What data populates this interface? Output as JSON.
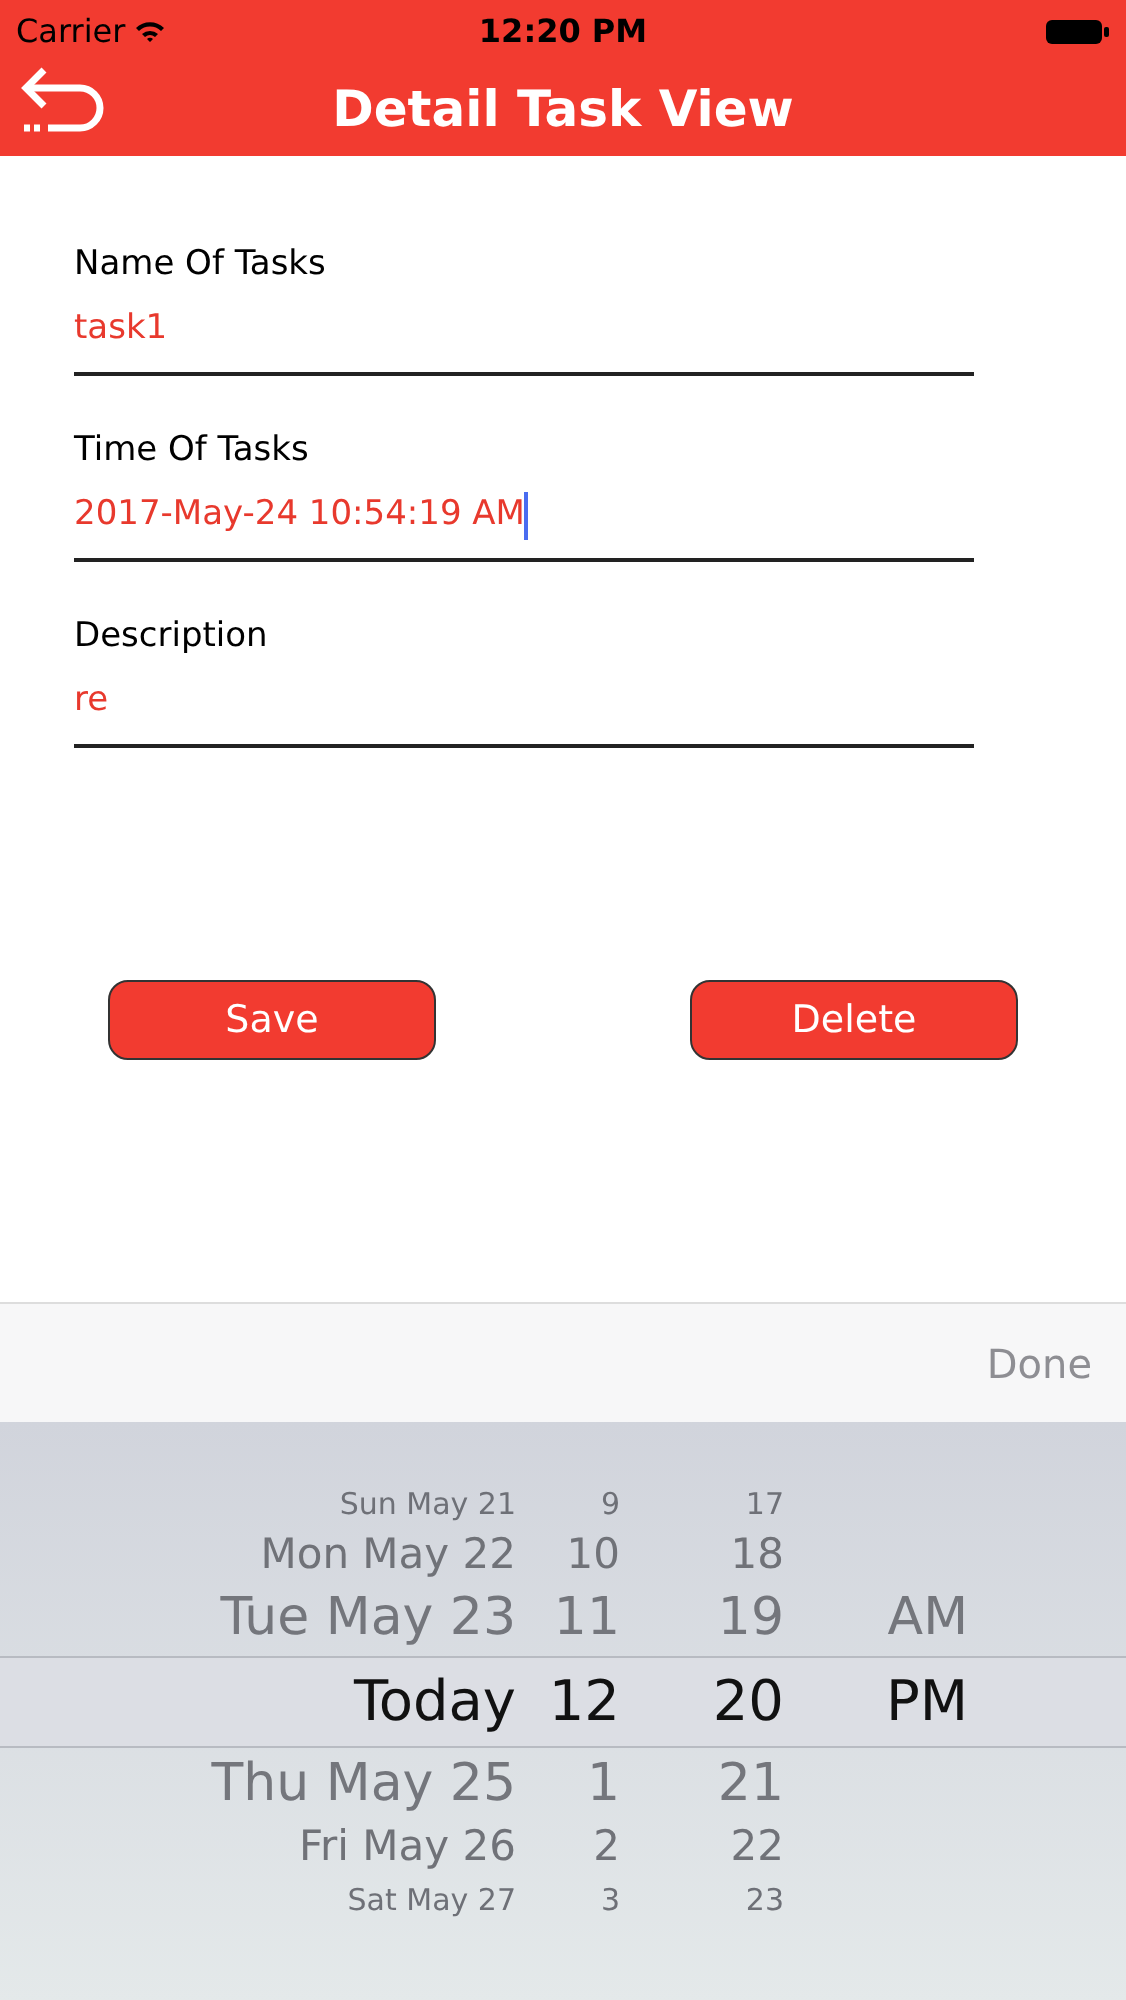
{
  "status_bar": {
    "carrier": "Carrier",
    "time": "12:20 PM"
  },
  "nav": {
    "title": "Detail Task View"
  },
  "fields": [
    {
      "label": "Name Of Tasks",
      "value": "task1",
      "focused": false
    },
    {
      "label": "Time Of Tasks",
      "value": "2017-May-24 10:54:19 AM",
      "focused": true
    },
    {
      "label": "Description",
      "value": "re",
      "focused": false
    }
  ],
  "buttons": [
    "Save",
    "Delete"
  ],
  "toolbar": {
    "done": "Done"
  },
  "picker": [
    {
      "date": "Sun May 21",
      "hour": "9",
      "minute": "17",
      "selected": false
    },
    {
      "date": "Mon May 22",
      "hour": "10",
      "minute": "18",
      "selected": false
    },
    {
      "date": "Tue May 23",
      "hour": "11",
      "minute": "19",
      "ampm": "AM",
      "selected": false
    },
    {
      "date": "Today",
      "hour": "12",
      "minute": "20",
      "ampm": "PM",
      "selected": true
    },
    {
      "date": "Thu May 25",
      "hour": "1",
      "minute": "21",
      "selected": false
    },
    {
      "date": "Fri May 26",
      "hour": "2",
      "minute": "22",
      "selected": false
    },
    {
      "date": "Sat May 27",
      "hour": "3",
      "minute": "23",
      "selected": false
    }
  ]
}
